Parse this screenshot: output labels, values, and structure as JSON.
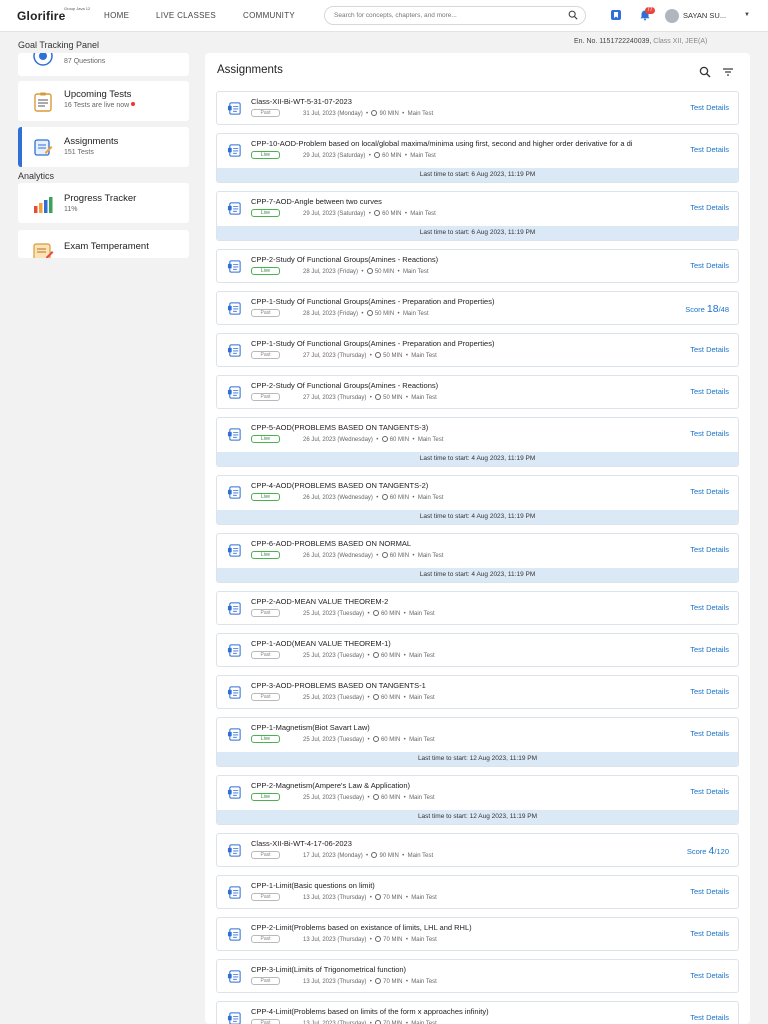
{
  "header": {
    "logo": "Glorifire",
    "logo_tag": "Group Java 12",
    "nav": [
      "HOME",
      "LIVE CLASSES",
      "COMMUNITY"
    ],
    "search_placeholder": "Search for concepts, chapters, and more...",
    "notification_count": "77",
    "user_name": "SAYAN SU..."
  },
  "sidebar": {
    "title": "Goal Tracking Panel",
    "top_card_sub": "87 Questions",
    "upcoming": {
      "title": "Upcoming Tests",
      "sub": "16 Tests are live now"
    },
    "assignments": {
      "title": "Assignments",
      "sub": "151 Tests"
    },
    "analytics_label": "Analytics",
    "progress": {
      "title": "Progress Tracker",
      "sub": "11%"
    },
    "exam": {
      "title": "Exam Temperament"
    }
  },
  "enrollment": {
    "number": "En. No. 1151722240039,",
    "class": "Class XII, JEE(A)"
  },
  "main": {
    "title": "Assignments"
  },
  "assignments": [
    {
      "title": "Class-XII-Bi-WT-5-31-07-2023",
      "status": "Past",
      "date": "31 Jul, 2023 (Monday)",
      "duration": "90 MIN",
      "type": "Main Test",
      "action": "Test Details",
      "last_time": ""
    },
    {
      "title": "CPP-10-AOD-Problem based on local/global maxima/minima using first, second and higher order derivative for a di",
      "status": "Live",
      "date": "29 Jul, 2023 (Saturday)",
      "duration": "60 MIN",
      "type": "Main Test",
      "action": "Test Details",
      "last_time": "Last time to start: 6 Aug 2023, 11:19 PM"
    },
    {
      "title": "CPP-7-AOD-Angle between two curves",
      "status": "Live",
      "date": "29 Jul, 2023 (Saturday)",
      "duration": "60 MIN",
      "type": "Main Test",
      "action": "Test Details",
      "last_time": "Last time to start: 6 Aug 2023, 11:19 PM"
    },
    {
      "title": "CPP-2-Study Of Functional Groups(Amines - Reactions)",
      "status": "Live",
      "date": "28 Jul, 2023 (Friday)",
      "duration": "50 MIN",
      "type": "Main Test",
      "action": "Test Details",
      "last_time": ""
    },
    {
      "title": "CPP-1-Study Of Functional Groups(Amines - Preparation and Properties)",
      "status": "Past",
      "date": "28 Jul, 2023 (Friday)",
      "duration": "50 MIN",
      "type": "Main Test",
      "action": "",
      "score_label": "Score",
      "score": "18",
      "score_total": "/48",
      "last_time": ""
    },
    {
      "title": "CPP-1-Study Of Functional Groups(Amines - Preparation and Properties)",
      "status": "Past",
      "date": "27 Jul, 2023 (Thursday)",
      "duration": "50 MIN",
      "type": "Main Test",
      "action": "Test Details",
      "last_time": ""
    },
    {
      "title": "CPP-2-Study Of Functional Groups(Amines - Reactions)",
      "status": "Past",
      "date": "27 Jul, 2023 (Thursday)",
      "duration": "50 MIN",
      "type": "Main Test",
      "action": "Test Details",
      "last_time": ""
    },
    {
      "title": "CPP-5-AOD(PROBLEMS BASED ON TANGENTS-3)",
      "status": "Live",
      "date": "26 Jul, 2023 (Wednesday)",
      "duration": "60 MIN",
      "type": "Main Test",
      "action": "Test Details",
      "last_time": "Last time to start: 4 Aug 2023, 11:19 PM"
    },
    {
      "title": "CPP-4-AOD(PROBLEMS BASED ON TANGENTS-2)",
      "status": "Live",
      "date": "26 Jul, 2023 (Wednesday)",
      "duration": "60 MIN",
      "type": "Main Test",
      "action": "Test Details",
      "last_time": "Last time to start: 4 Aug 2023, 11:19 PM"
    },
    {
      "title": "CPP-6-AOD-PROBLEMS BASED ON NORMAL",
      "status": "Live",
      "date": "26 Jul, 2023 (Wednesday)",
      "duration": "60 MIN",
      "type": "Main Test",
      "action": "Test Details",
      "last_time": "Last time to start: 4 Aug 2023, 11:19 PM"
    },
    {
      "title": "CPP-2-AOD-MEAN VALUE THEOREM-2",
      "status": "Past",
      "date": "25 Jul, 2023 (Tuesday)",
      "duration": "60 MIN",
      "type": "Main Test",
      "action": "Test Details",
      "last_time": ""
    },
    {
      "title": "CPP-1-AOD(MEAN VALUE THEOREM-1)",
      "status": "Past",
      "date": "25 Jul, 2023 (Tuesday)",
      "duration": "60 MIN",
      "type": "Main Test",
      "action": "Test Details",
      "last_time": ""
    },
    {
      "title": "CPP-3-AOD-PROBLEMS BASED ON TANGENTS-1",
      "status": "Past",
      "date": "25 Jul, 2023 (Tuesday)",
      "duration": "60 MIN",
      "type": "Main Test",
      "action": "Test Details",
      "last_time": ""
    },
    {
      "title": "CPP-1-Magnetism(Biot Savart Law)",
      "status": "Live",
      "date": "25 Jul, 2023 (Tuesday)",
      "duration": "60 MIN",
      "type": "Main Test",
      "action": "Test Details",
      "last_time": "Last time to start: 12 Aug 2023, 11:19 PM"
    },
    {
      "title": "CPP-2-Magnetism(Ampere's Law & Application)",
      "status": "Live",
      "date": "25 Jul, 2023 (Tuesday)",
      "duration": "60 MIN",
      "type": "Main Test",
      "action": "Test Details",
      "last_time": "Last time to start: 12 Aug 2023, 11:19 PM"
    },
    {
      "title": "Class-XII-Bi-WT-4-17-06-2023",
      "status": "Past",
      "date": "17 Jul, 2023 (Monday)",
      "duration": "90 MIN",
      "type": "Main Test",
      "action": "",
      "score_label": "Score",
      "score": "4",
      "score_total": "/120",
      "last_time": ""
    },
    {
      "title": "CPP-1-Limit(Basic questions on limit)",
      "status": "Past",
      "date": "13 Jul, 2023 (Thursday)",
      "duration": "70 MIN",
      "type": "Main Test",
      "action": "Test Details",
      "last_time": ""
    },
    {
      "title": "CPP-2-Limit(Problems based on existance of limits, LHL and RHL)",
      "status": "Past",
      "date": "13 Jul, 2023 (Thursday)",
      "duration": "70 MIN",
      "type": "Main Test",
      "action": "Test Details",
      "last_time": ""
    },
    {
      "title": "CPP-3-Limit(Limits of Trigonometrical function)",
      "status": "Past",
      "date": "13 Jul, 2023 (Thursday)",
      "duration": "70 MIN",
      "type": "Main Test",
      "action": "Test Details",
      "last_time": ""
    },
    {
      "title": "CPP-4-Limit(Problems based on limits of the form x approaches infinity)",
      "status": "Past",
      "date": "13 Jul, 2023 (Thursday)",
      "duration": "70 MIN",
      "type": "Main Test",
      "action": "Test Details",
      "last_time": ""
    }
  ]
}
